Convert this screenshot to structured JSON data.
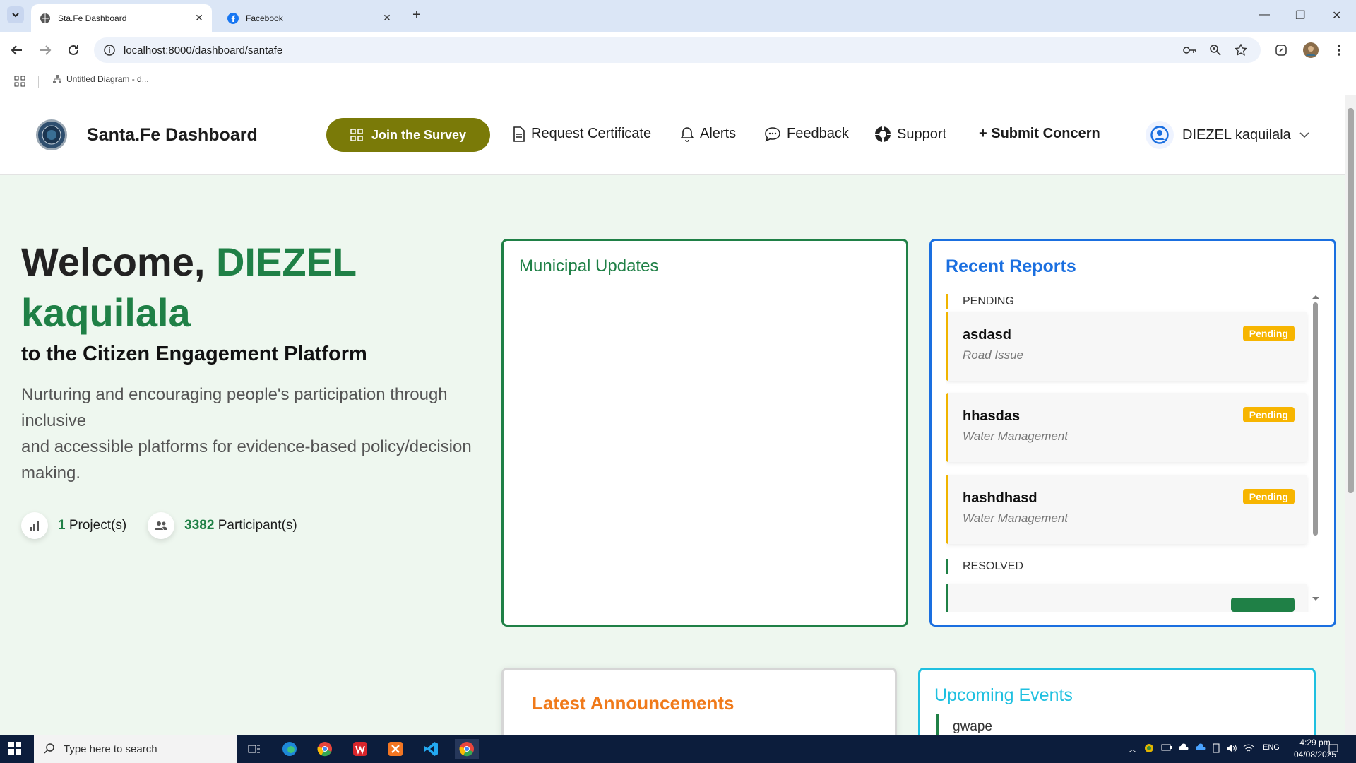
{
  "browser": {
    "tabs": [
      {
        "title": "Sta.Fe Dashboard",
        "active": true
      },
      {
        "title": "Facebook",
        "active": false
      }
    ],
    "url": "localhost:8000/dashboard/santafe",
    "bookmark": "Untitled Diagram - d..."
  },
  "header": {
    "brand": "Santa.Fe Dashboard",
    "survey_button": "Join the Survey",
    "nav": {
      "request_certificate": "Request Certificate",
      "alerts": "Alerts",
      "feedback": "Feedback",
      "support": "Support",
      "submit_concern": "+ Submit Concern"
    },
    "user_name": "DIEZEL kaquilala"
  },
  "hero": {
    "welcome_prefix": "Welcome,",
    "first_name": "DIEZEL",
    "last_name": "kaquilala",
    "subtitle": "to the Citizen Engagement Platform",
    "desc_line1": "Nurturing and encouraging people's participation through inclusive",
    "desc_line2": "and accessible platforms for evidence-based policy/decision making.",
    "projects_count": "1",
    "projects_label": "Project(s)",
    "participants_count": "3382",
    "participants_label": "Participant(s)"
  },
  "municipal": {
    "title": "Municipal Updates"
  },
  "reports": {
    "title": "Recent Reports",
    "pending_label": "PENDING",
    "resolved_label": "RESOLVED",
    "items": [
      {
        "title": "asdasd",
        "category": "Road Issue",
        "status": "Pending"
      },
      {
        "title": "hhasdas",
        "category": "Water Management",
        "status": "Pending"
      },
      {
        "title": "hashdhasd",
        "category": "Water Management",
        "status": "Pending"
      }
    ]
  },
  "announcements": {
    "title": "Latest Announcements"
  },
  "events": {
    "title": "Upcoming Events",
    "first_item": "gwape"
  },
  "taskbar": {
    "search_placeholder": "Type here to search",
    "lang": "ENG",
    "time": "4:29 pm",
    "date": "04/08/2025"
  },
  "colors": {
    "green": "#1f8046",
    "olive": "#7a7a08",
    "blue": "#1a6fe0",
    "orange": "#f07a1a",
    "cyan": "#1fc0e0",
    "pending": "#f7b500"
  }
}
